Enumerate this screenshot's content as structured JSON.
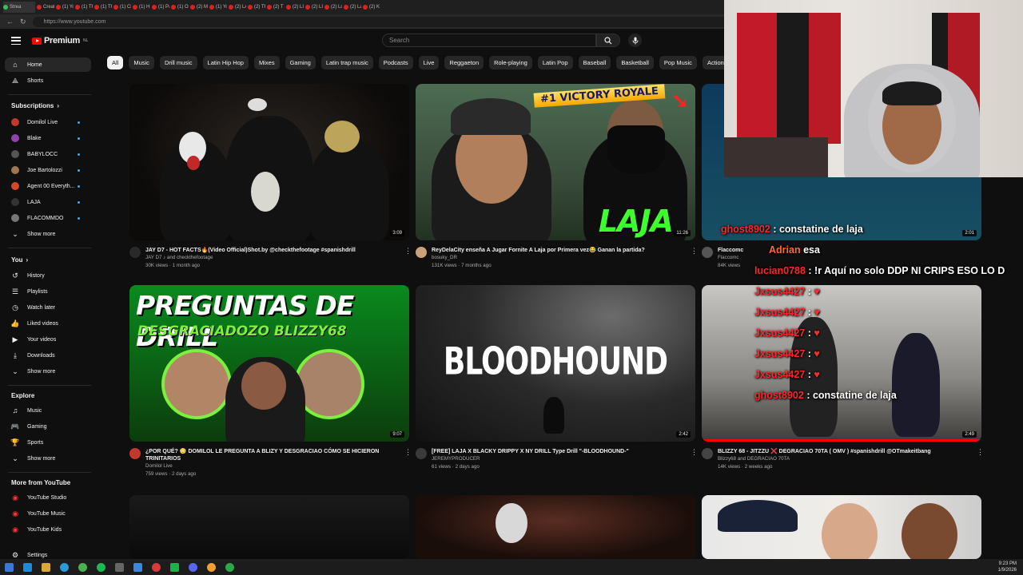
{
  "browser": {
    "tabs": [
      "Strea",
      "Creat",
      "(1) Yo",
      "(1) Th",
      "(1) Th",
      "(1) Cl",
      "(1) H",
      "(1) Pa",
      "(1) O",
      "(2) M",
      "(1) Yo",
      "(2) LA",
      "(2) Th",
      "(2) T",
      "(2) LI",
      "(2) LI",
      "(2) Lo",
      "(2) La",
      "(2) K"
    ],
    "url": "https://www.youtube.com"
  },
  "header": {
    "logo": "Premium",
    "logo_sup": "NL",
    "search_placeholder": "Search"
  },
  "chips": [
    "All",
    "Music",
    "Drill music",
    "Latin Hip Hop",
    "Mixes",
    "Gaming",
    "Latin trap music",
    "Podcasts",
    "Live",
    "Reggaeton",
    "Role-playing",
    "Latin Pop",
    "Baseball",
    "Basketball",
    "Pop Music",
    "Action-adventure"
  ],
  "sidebar": {
    "home": "Home",
    "shorts": "Shorts",
    "subscriptions_title": "Subscriptions",
    "subscriptions": [
      {
        "name": "Domilol Live",
        "color": "#c0392b"
      },
      {
        "name": "Blake",
        "color": "#8e44ad"
      },
      {
        "name": "BABYLOCC",
        "color": "#555555"
      },
      {
        "name": "Joe Bartolozzi",
        "color": "#a07850"
      },
      {
        "name": "Agent 00 Everyth...",
        "color": "#d04a2a"
      },
      {
        "name": "LAJA",
        "color": "#333333"
      },
      {
        "name": "FLACOMMDO",
        "color": "#777777"
      }
    ],
    "show_more": "Show more",
    "you_title": "You",
    "you_items": [
      "History",
      "Playlists",
      "Watch later",
      "Liked videos",
      "Your videos",
      "Downloads"
    ],
    "explore_title": "Explore",
    "explore_items": [
      "Music",
      "Gaming",
      "Sports"
    ],
    "more_title": "More from YouTube",
    "more_items": [
      "YouTube Studio",
      "YouTube Music",
      "YouTube Kids"
    ],
    "settings": "Settings"
  },
  "videos": [
    {
      "title": "JAY D7 - HOT FACTS🔥(Video Official)Shot.by @checkthefootage #spanishdrill",
      "channel": "JAY D7 ♪ and checkthefootage",
      "stats": "30K views · 1 month ago",
      "duration": "3:09"
    },
    {
      "title": "ReyDelaCity enseña A Jugar Fornite A Laja por Primera vez😂 Ganan la partida?",
      "channel": "bosuky_DR",
      "stats": "131K views · 7 months ago",
      "duration": "11:26",
      "thumb_banner": "#1 VICTORY ROYALE",
      "thumb_text": "LAJA"
    },
    {
      "title": "Flaccomc",
      "channel": "Flaccomc",
      "stats": "84K views",
      "duration": "2:01"
    },
    {
      "title": "¿POR QUÉ? 😳 DOMILOL LE PREGUNTA A BLIZY Y DESGRACIAO CÓMO SE HICIERON TRINITARIOS",
      "channel": "Domilol Live",
      "stats": "759 views · 2 days ago",
      "duration": "9:07",
      "thumb_line1": "PREGUNTAS DE DRILL",
      "thumb_line2": "DESGRACIADOZO BLIZZY68"
    },
    {
      "title": "[FREE] LAJA X BLACKY DRIPPY X NY DRILL Type Drill \"-BLOODHOUND-\"",
      "channel": "JEREMYPRODUCER",
      "stats": "61 views · 2 days ago",
      "duration": "2:42",
      "thumb_text": "BLOODHOUND"
    },
    {
      "title": "BLIZZY 68 - JITZZU ❌ DEGRACIAO 70TA ( OMV ) #spanishdrill @OTmakeitbang",
      "channel": "Blizzy68 and DEGRACIAO 70TA",
      "stats": "14K views · 2 weeks ago",
      "duration": "2:49"
    }
  ],
  "chat": {
    "top_name": "Adrian",
    "top_text": "esa",
    "lines": [
      {
        "user": "ghost8902",
        "text": ": constatine de laja"
      },
      {
        "user": "lucian0788",
        "text": ": !r Aquí no solo DDP NI CRIPS ESO LO D"
      },
      {
        "user": "Jxsus4427",
        "text": ":"
      },
      {
        "user": "Jxsus4427",
        "text": ":"
      },
      {
        "user": "Jxsus4427",
        "text": ":"
      },
      {
        "user": "Jxsus4427",
        "text": ":"
      },
      {
        "user": "Jxsus4427",
        "text": ":"
      },
      {
        "user": "ghost8902",
        "text": ": constatine de laja"
      }
    ]
  },
  "taskbar": {
    "time": "9:23 PM",
    "date": "1/9/2026"
  }
}
